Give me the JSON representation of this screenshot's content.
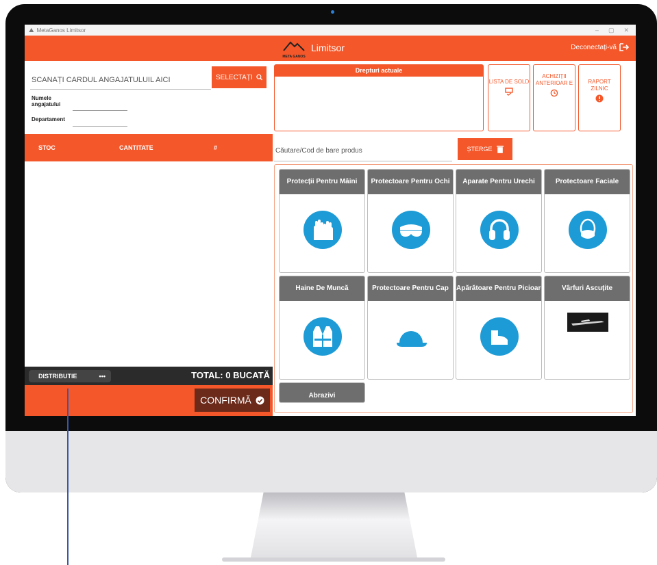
{
  "window": {
    "title": "MetaGanos Limitsor",
    "controls": [
      "–",
      "▢",
      "✕"
    ]
  },
  "header": {
    "logo_text": "META GANOS",
    "title": "Limitsor",
    "logout_label": "Deconectați-vă"
  },
  "left_panel": {
    "scan_placeholder": "SCANAȚI CARDUL ANGAJATULUIL AICI",
    "select_label": "SELECTAȚI",
    "employee_name_label": "Numele angajatului",
    "department_label": "Departament",
    "columns": [
      "STOC",
      "CANTITATE",
      "#"
    ],
    "distribution_label": "DISTRIBUTIE",
    "distribution_more": "•••",
    "total_label": "TOTAL: 0 BUCATĂ",
    "confirm_label": "CONFIRMĂ"
  },
  "rights_panel": {
    "header": "Drepturi actuale"
  },
  "side_buttons": [
    {
      "label": "LISTA DE SOLD",
      "icon": "list-check-icon"
    },
    {
      "label": "ACHIZIȚII ANTERIOAR E",
      "icon": "history-icon"
    },
    {
      "label": "RAPORT ZILNIC",
      "icon": "alert-icon"
    }
  ],
  "product_search": {
    "placeholder": "Căutare/Cod de bare produs",
    "clear_label": "ȘTERGE"
  },
  "categories": [
    {
      "title": "Protecții Pentru Mâini",
      "icon": "gloves-icon"
    },
    {
      "title": "Protectoare Pentru Ochi",
      "icon": "goggles-icon"
    },
    {
      "title": "Aparate Pentru Urechi",
      "icon": "ear-protection-icon"
    },
    {
      "title": "Protectoare Faciale",
      "icon": "face-mask-icon"
    },
    {
      "title": "Haine De Muncă",
      "icon": "safety-vest-icon"
    },
    {
      "title": "Protectoare Pentru Cap",
      "icon": "hard-hat-icon"
    },
    {
      "title": "Apărătoare Pentru Picioare",
      "icon": "safety-boot-icon"
    },
    {
      "title": "Vârfuri Ascuțite",
      "icon": "product-photo"
    },
    {
      "title": "Abrazivi",
      "icon": ""
    }
  ],
  "colors": {
    "accent": "#f4572a",
    "icon_blue": "#1d9bd6",
    "card_header": "#6e6e6e"
  }
}
